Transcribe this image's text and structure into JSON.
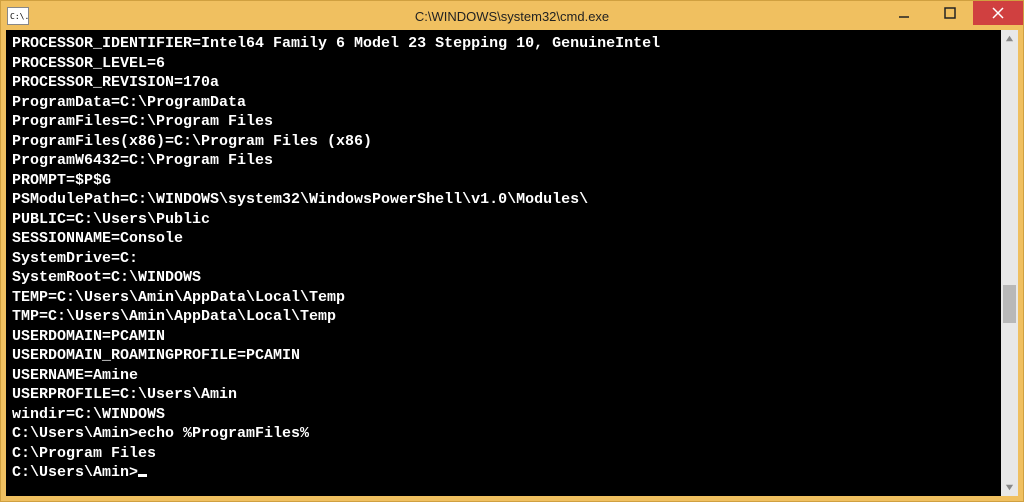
{
  "titlebar": {
    "icon_text": "C:\\.",
    "title": "C:\\WINDOWS\\system32\\cmd.exe"
  },
  "console": {
    "lines": [
      "PROCESSOR_IDENTIFIER=Intel64 Family 6 Model 23 Stepping 10, GenuineIntel",
      "PROCESSOR_LEVEL=6",
      "PROCESSOR_REVISION=170a",
      "ProgramData=C:\\ProgramData",
      "ProgramFiles=C:\\Program Files",
      "ProgramFiles(x86)=C:\\Program Files (x86)",
      "ProgramW6432=C:\\Program Files",
      "PROMPT=$P$G",
      "PSModulePath=C:\\WINDOWS\\system32\\WindowsPowerShell\\v1.0\\Modules\\",
      "PUBLIC=C:\\Users\\Public",
      "SESSIONNAME=Console",
      "SystemDrive=C:",
      "SystemRoot=C:\\WINDOWS",
      "TEMP=C:\\Users\\Amin\\AppData\\Local\\Temp",
      "TMP=C:\\Users\\Amin\\AppData\\Local\\Temp",
      "USERDOMAIN=PCAMIN",
      "USERDOMAIN_ROAMINGPROFILE=PCAMIN",
      "USERNAME=Amine",
      "USERPROFILE=C:\\Users\\Amin",
      "windir=C:\\WINDOWS",
      "",
      "C:\\Users\\Amin>echo %ProgramFiles%",
      "C:\\Program Files",
      ""
    ],
    "prompt": "C:\\Users\\Amin>"
  }
}
